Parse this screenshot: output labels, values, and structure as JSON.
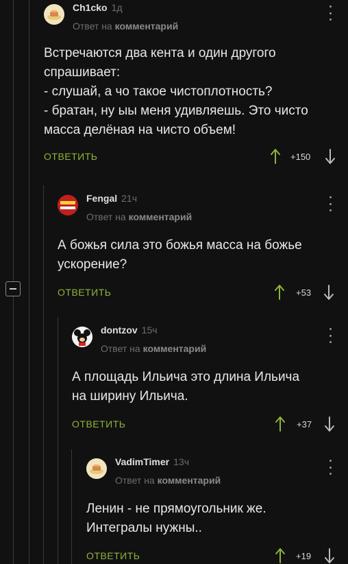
{
  "labels": {
    "reply_to": "Ответ на",
    "comment_word": "комментарий",
    "reply_button": "ОТВЕТИТЬ"
  },
  "colors": {
    "background": "#111111",
    "accent_green": "#8fb43a",
    "muted": "#6e6e6e"
  },
  "comments": [
    {
      "author": "Ch1cko",
      "time": "1д",
      "avatar_icon": "food-plate-icon",
      "text_lines": [
        "Встречаются два кента и один другого",
        "спрашивает:",
        "- слушай, а чо такое чистоплотность?",
        "- братан, ну ыы меня удивляешь. Это чисто",
        "масса делёная на чисто объем!"
      ],
      "score": "+150"
    },
    {
      "author": "Fengal",
      "time": "21ч",
      "avatar_icon": "badge-logo-icon",
      "text_lines": [
        "А божья сила это божья масса на божье",
        "ускорение?"
      ],
      "score": "+53"
    },
    {
      "author": "dontzov",
      "time": "15ч",
      "avatar_icon": "mickey-mouse-icon",
      "text_lines": [
        "А площадь Ильича это длина Ильича",
        "на ширину Ильича."
      ],
      "score": "+37"
    },
    {
      "author": "VadimTimer",
      "time": "13ч",
      "avatar_icon": "food-plate-icon",
      "text_lines": [
        "Ленин - не прямоугольник же.",
        "Интегралы нужны.."
      ],
      "score": "+19"
    }
  ]
}
